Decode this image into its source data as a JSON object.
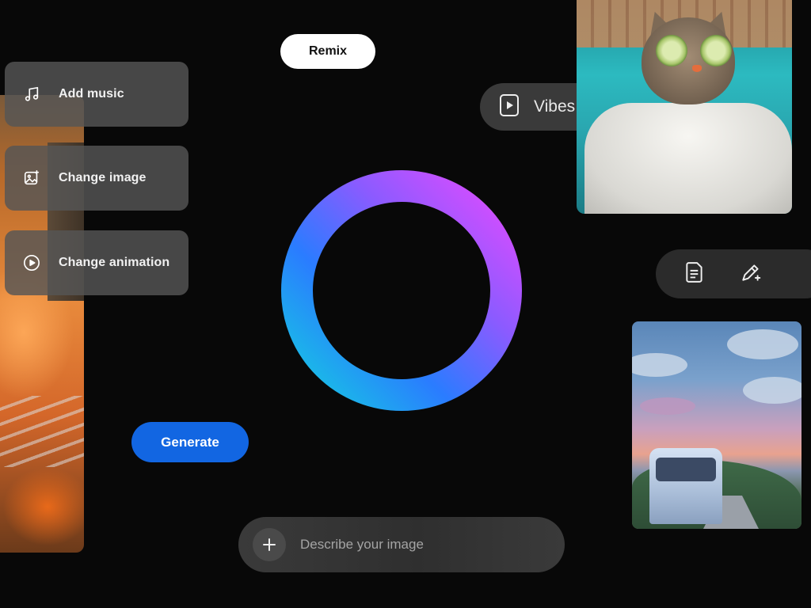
{
  "remix": {
    "label": "Remix"
  },
  "vibes": {
    "label": "Vibes",
    "icon": "play-square-icon"
  },
  "options": [
    {
      "label": "Add music",
      "icon": "music-note-icon"
    },
    {
      "label": "Change image",
      "icon": "image-sparkle-icon"
    },
    {
      "label": "Change animation",
      "icon": "play-circle-icon"
    }
  ],
  "generate": {
    "label": "Generate"
  },
  "prompt": {
    "placeholder": "Describe your image",
    "value": "",
    "icon": "plus-icon"
  },
  "toolbar": {
    "icons": [
      "document-icon",
      "pencil-sparkle-icon"
    ]
  },
  "colors": {
    "accent": "#1266e2",
    "ring_gradient": [
      "#c94cff",
      "#6a5cff",
      "#1b7bff",
      "#19c3e6"
    ],
    "card_bg": "#555555",
    "background": "#080808"
  }
}
